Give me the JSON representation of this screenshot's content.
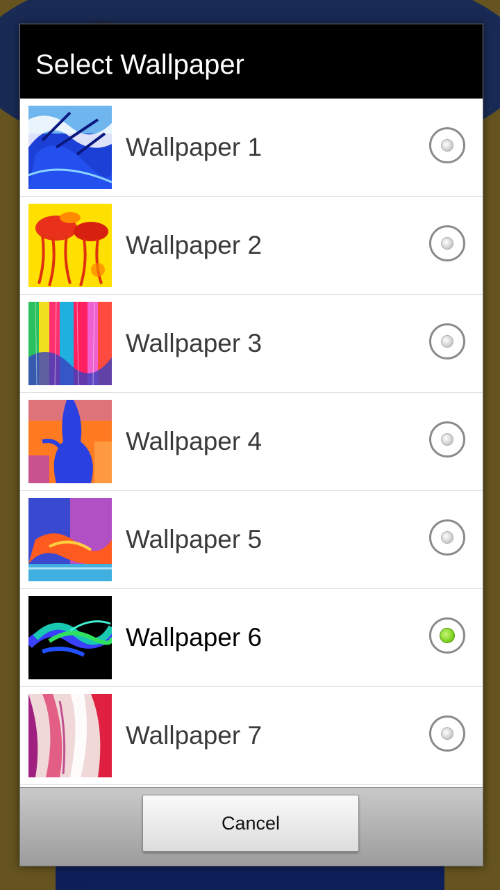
{
  "dialog": {
    "title": "Select Wallpaper",
    "cancel_label": "Cancel"
  },
  "wallpapers": [
    {
      "label": "Wallpaper 1",
      "selected": false,
      "colors": [
        "#1a3ad8",
        "#5ad0f0",
        "#ffffff"
      ]
    },
    {
      "label": "Wallpaper 2",
      "selected": false,
      "colors": [
        "#ffe600",
        "#ff9a00",
        "#d42010"
      ]
    },
    {
      "label": "Wallpaper 3",
      "selected": false,
      "colors": [
        "#ff2a6a",
        "#2ad05a",
        "#3a40c0"
      ]
    },
    {
      "label": "Wallpaper 4",
      "selected": false,
      "colors": [
        "#ff7a20",
        "#2a40e0",
        "#b040c0"
      ]
    },
    {
      "label": "Wallpaper 5",
      "selected": false,
      "colors": [
        "#3a4ad0",
        "#ff5a20",
        "#d050c0"
      ]
    },
    {
      "label": "Wallpaper 6",
      "selected": true,
      "colors": [
        "#000000",
        "#1ad0a0",
        "#3a40ff"
      ]
    },
    {
      "label": "Wallpaper 7",
      "selected": false,
      "colors": [
        "#f0d8d8",
        "#e02040",
        "#a02080"
      ]
    }
  ],
  "radio_checked_color": "#7ed321"
}
